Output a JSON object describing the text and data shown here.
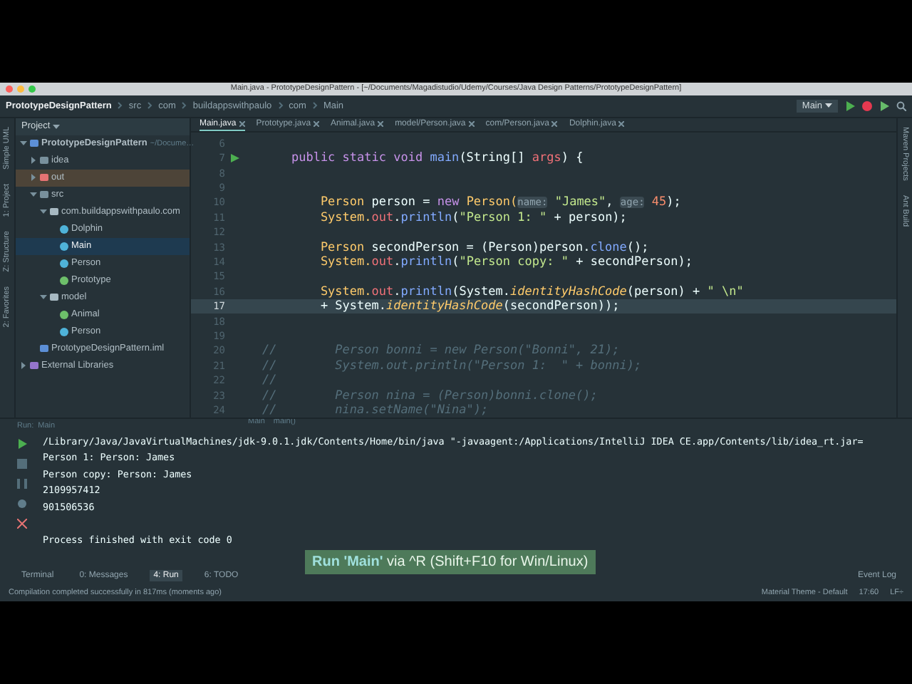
{
  "window": {
    "title": "Main.java - PrototypeDesignPattern - [~/Documents/Magadistudio/Udemy/Courses/Java Design Patterns/PrototypeDesignPattern]"
  },
  "breadcrumbs": [
    "PrototypeDesignPattern",
    "src",
    "com",
    "buildappswithpaulo",
    "com",
    "Main"
  ],
  "run_config": {
    "label": "Main"
  },
  "left_strip": [
    "Simple UML",
    "1: Project",
    "Z: Structure",
    "2: Favorites"
  ],
  "right_strip": [
    "Maven Projects",
    "Ant Build"
  ],
  "project": {
    "header": "Project",
    "tree": [
      {
        "label": "PrototypeDesignPattern",
        "note": "~/Docume…",
        "kind": "project",
        "expanded": true,
        "selected": false,
        "children": [
          {
            "label": "idea",
            "kind": "folder",
            "expanded": false,
            "selected": false
          },
          {
            "label": "out",
            "kind": "excluded",
            "expanded": false,
            "selected": false
          },
          {
            "label": "src",
            "kind": "folder",
            "expanded": true,
            "selected": false,
            "children": [
              {
                "label": "com.buildappswithpaulo.com",
                "kind": "package",
                "expanded": true,
                "selected": false,
                "children": [
                  {
                    "label": "Dolphin",
                    "kind": "class",
                    "selected": false
                  },
                  {
                    "label": "Main",
                    "kind": "class",
                    "selected": true
                  },
                  {
                    "label": "Person",
                    "kind": "class",
                    "selected": false
                  },
                  {
                    "label": "Prototype",
                    "kind": "interface",
                    "selected": false
                  }
                ]
              },
              {
                "label": "model",
                "kind": "package",
                "expanded": true,
                "selected": false,
                "children": [
                  {
                    "label": "Animal",
                    "kind": "interface",
                    "selected": false
                  },
                  {
                    "label": "Person",
                    "kind": "class",
                    "selected": false
                  }
                ]
              }
            ]
          },
          {
            "label": "PrototypeDesignPattern.iml",
            "kind": "module",
            "selected": false
          }
        ]
      },
      {
        "label": "External Libraries",
        "kind": "library",
        "expanded": false,
        "selected": false
      }
    ]
  },
  "tabs": [
    {
      "label": "Main.java",
      "selected": true
    },
    {
      "label": "Prototype.java",
      "selected": false
    },
    {
      "label": "Animal.java",
      "selected": false
    },
    {
      "label": "model/Person.java",
      "selected": false
    },
    {
      "label": "com/Person.java",
      "selected": false
    },
    {
      "label": "Dolphin.java",
      "selected": false
    }
  ],
  "code": [
    {
      "n": "6",
      "current": false
    },
    {
      "n": "7",
      "current": false,
      "run": true,
      "tokens": [
        {
          "t": "    public static void ",
          "kind": "kw"
        },
        {
          "t": "main",
          "kind": "method"
        },
        {
          "t": "(String[] ",
          "kind": "plain"
        },
        {
          "t": "args",
          "kind": "field"
        },
        {
          "t": ") {",
          "kind": "plain"
        }
      ]
    },
    {
      "n": "8",
      "current": false
    },
    {
      "n": "9",
      "current": false
    },
    {
      "n": "10",
      "current": false,
      "tokens": [
        {
          "t": "        Person ",
          "kind": "type"
        },
        {
          "t": "person = ",
          "kind": "plain"
        },
        {
          "t": "new ",
          "kind": "kw"
        },
        {
          "t": "Person(",
          "kind": "type"
        },
        {
          "t": "name:",
          "kind": "hint"
        },
        {
          "t": " \"James\"",
          "kind": "str"
        },
        {
          "t": ", ",
          "kind": "plain"
        },
        {
          "t": "age:",
          "kind": "hint"
        },
        {
          "t": " 45",
          "kind": "num"
        },
        {
          "t": ");",
          "kind": "plain"
        }
      ]
    },
    {
      "n": "11",
      "current": false,
      "tokens": [
        {
          "t": "        System.",
          "kind": "type"
        },
        {
          "t": "out",
          "kind": "field"
        },
        {
          "t": ".",
          "kind": "plain"
        },
        {
          "t": "println",
          "kind": "method"
        },
        {
          "t": "(",
          "kind": "plain"
        },
        {
          "t": "\"Person 1: \"",
          "kind": "str"
        },
        {
          "t": " + person);",
          "kind": "plain"
        }
      ]
    },
    {
      "n": "12",
      "current": false
    },
    {
      "n": "13",
      "current": false,
      "tokens": [
        {
          "t": "        Person ",
          "kind": "type"
        },
        {
          "t": "secondPerson = (Person)person.",
          "kind": "plain"
        },
        {
          "t": "clone",
          "kind": "method"
        },
        {
          "t": "();",
          "kind": "plain"
        }
      ]
    },
    {
      "n": "14",
      "current": false,
      "tokens": [
        {
          "t": "        System.",
          "kind": "type"
        },
        {
          "t": "out",
          "kind": "field"
        },
        {
          "t": ".",
          "kind": "plain"
        },
        {
          "t": "println",
          "kind": "method"
        },
        {
          "t": "(",
          "kind": "plain"
        },
        {
          "t": "\"Person copy: \"",
          "kind": "str"
        },
        {
          "t": " + secondPerson);",
          "kind": "plain"
        }
      ]
    },
    {
      "n": "15",
      "current": false
    },
    {
      "n": "16",
      "current": false,
      "tokens": [
        {
          "t": "        System.",
          "kind": "type"
        },
        {
          "t": "out",
          "kind": "field"
        },
        {
          "t": ".",
          "kind": "plain"
        },
        {
          "t": "println",
          "kind": "method"
        },
        {
          "t": "(System.",
          "kind": "plain"
        },
        {
          "t": "identityHashCode",
          "kind": "italic"
        },
        {
          "t": "(person) + ",
          "kind": "plain"
        },
        {
          "t": "\" \\n\"",
          "kind": "str"
        }
      ]
    },
    {
      "n": "17",
      "current": true,
      "tokens": [
        {
          "t": "        + System.",
          "kind": "plain"
        },
        {
          "t": "identityHashCode",
          "kind": "italic"
        },
        {
          "t": "(secondPerson));",
          "kind": "plain"
        }
      ]
    },
    {
      "n": "18",
      "current": false
    },
    {
      "n": "19",
      "current": false
    },
    {
      "n": "20",
      "current": false,
      "tokens": [
        {
          "t": "//        Person bonni = new Person(\"Bonni\", 21);",
          "kind": "comment"
        }
      ]
    },
    {
      "n": "21",
      "current": false,
      "tokens": [
        {
          "t": "//        System.out.println(\"Person 1:  \" + bonni);",
          "kind": "comment"
        }
      ]
    },
    {
      "n": "22",
      "current": false,
      "tokens": [
        {
          "t": "//",
          "kind": "comment"
        }
      ]
    },
    {
      "n": "23",
      "current": false,
      "tokens": [
        {
          "t": "//        Person nina = (Person)bonni.clone();",
          "kind": "comment"
        }
      ]
    },
    {
      "n": "24",
      "current": false,
      "tokens": [
        {
          "t": "//        nina.setName(\"Nina\");",
          "kind": "comment"
        }
      ]
    }
  ],
  "editor_breadcrumbs": [
    "Main",
    "main()"
  ],
  "run_panel": {
    "label": "Run:",
    "config": "Main",
    "output": [
      "/Library/Java/JavaVirtualMachines/jdk-9.0.1.jdk/Contents/Home/bin/java \"-javaagent:/Applications/IntelliJ IDEA CE.app/Contents/lib/idea_rt.jar=",
      "Person 1: Person: James",
      "Person copy: Person: James",
      "2109957412",
      "901506536"
    ],
    "exit_message": "Process finished with exit code 0"
  },
  "overlay_hint": "**Run 'Main'** via ^R (Shift+F10 for Win/Linux)",
  "tool_tabs": [
    {
      "label": "Terminal",
      "selected": false
    },
    {
      "label": "0: Messages",
      "selected": false
    },
    {
      "label": "4: Run",
      "selected": true
    },
    {
      "label": "6: TODO",
      "selected": false
    }
  ],
  "event_log": "Event Log",
  "status_bar": {
    "message": "Compilation completed successfully in 817ms (moments ago)",
    "theme": "Material Theme - Default",
    "position": "17:60",
    "line_sep": "LF÷"
  }
}
